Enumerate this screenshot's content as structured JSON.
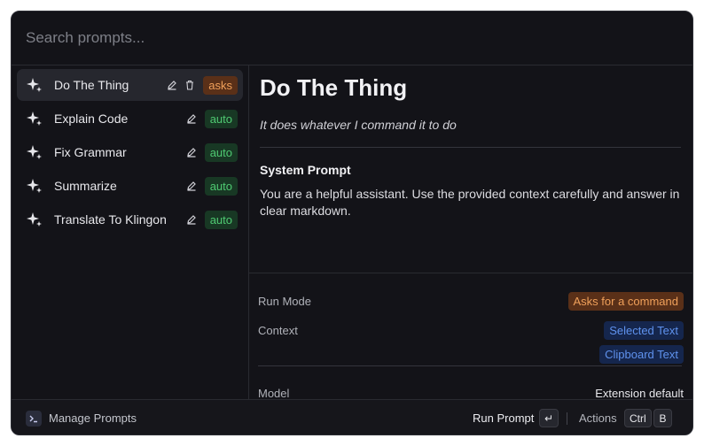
{
  "search": {
    "placeholder": "Search prompts..."
  },
  "prompts": [
    {
      "name": "Do The Thing",
      "badge": "asks",
      "selected": true
    },
    {
      "name": "Explain Code",
      "badge": "auto"
    },
    {
      "name": "Fix Grammar",
      "badge": "auto"
    },
    {
      "name": "Summarize",
      "badge": "auto"
    },
    {
      "name": "Translate To Klingon",
      "badge": "auto"
    }
  ],
  "detail": {
    "title": "Do The Thing",
    "description": "It does whatever I command it to do",
    "system_prompt_heading": "System Prompt",
    "system_prompt_body": "You are a helpful assistant. Use the provided context carefully and answer in clear markdown.",
    "run_mode_label": "Run Mode",
    "run_mode_value": "Asks for a command",
    "context_label": "Context",
    "context_values": [
      "Selected Text",
      "Clipboard Text"
    ],
    "model_label": "Model",
    "model_value": "Extension default"
  },
  "footer": {
    "manage_label": "Manage Prompts",
    "run_label": "Run Prompt",
    "run_key": "↵",
    "actions_label": "Actions",
    "actions_keys": [
      "Ctrl",
      "B"
    ]
  },
  "icons": {
    "prompt": "sparkles-icon",
    "edit": "pencil-icon",
    "delete": "trash-icon",
    "app": "terminal-icon"
  },
  "colors": {
    "background": "#131318",
    "asks_badge": "#f0a05a",
    "auto_badge": "#4fca72",
    "context_pill": "#5f92ee"
  }
}
